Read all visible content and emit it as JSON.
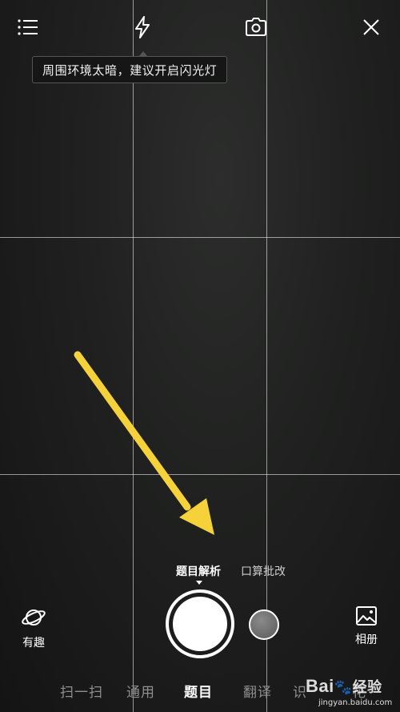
{
  "tooltip": {
    "text": "周围环境太暗，建议开启闪光灯"
  },
  "modes": {
    "active": "题目解析",
    "secondary": "口算批改"
  },
  "side": {
    "left_label": "有趣",
    "right_label": "相册"
  },
  "tabs": [
    "扫一扫",
    "通用",
    "题目",
    "翻译",
    "识",
    "花"
  ],
  "watermark": {
    "brand": "Bai",
    "brand2": "经验",
    "url": "jingyan.baidu.com"
  },
  "icons": {
    "menu": "list-icon",
    "flash": "lightning-icon",
    "rotate": "camera-switch-icon",
    "close": "close-icon",
    "fun": "planet-icon",
    "album": "image-icon"
  },
  "colors": {
    "annotation_arrow": "#f6d23a",
    "background": "#1f201f"
  }
}
